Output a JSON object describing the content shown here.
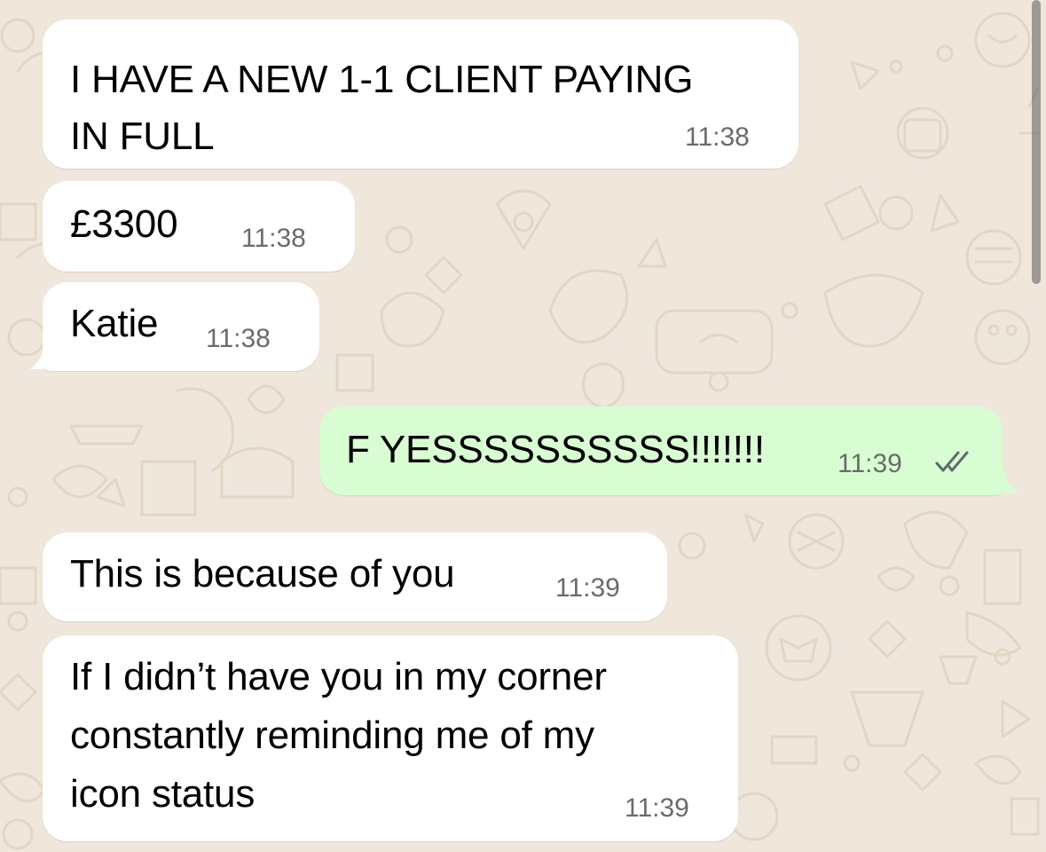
{
  "theme": {
    "incoming_bubble": "#ffffff",
    "outgoing_bubble": "#d9fdd3",
    "wallpaper": "#efe7dc",
    "timestamp_color": "#6b6b6b",
    "read_receipt_color": "#5f6b6b"
  },
  "messages": [
    {
      "direction": "incoming",
      "text": "I HAVE A NEW 1-1 CLIENT PAYING\nIN FULL",
      "time": "11:38"
    },
    {
      "direction": "incoming",
      "text": "£3300",
      "time": "11:38"
    },
    {
      "direction": "incoming",
      "text": "Katie",
      "time": "11:38"
    },
    {
      "direction": "outgoing",
      "text": "F YESSSSSSSSSS!!!!!!!",
      "time": "11:39",
      "status_icon": "double-check-icon"
    },
    {
      "direction": "incoming",
      "text": "This is because of you",
      "time": "11:39"
    },
    {
      "direction": "incoming",
      "text": "If I didn’t have you in my corner\nconstantly reminding me of my\nicon status",
      "time": "11:39"
    }
  ]
}
